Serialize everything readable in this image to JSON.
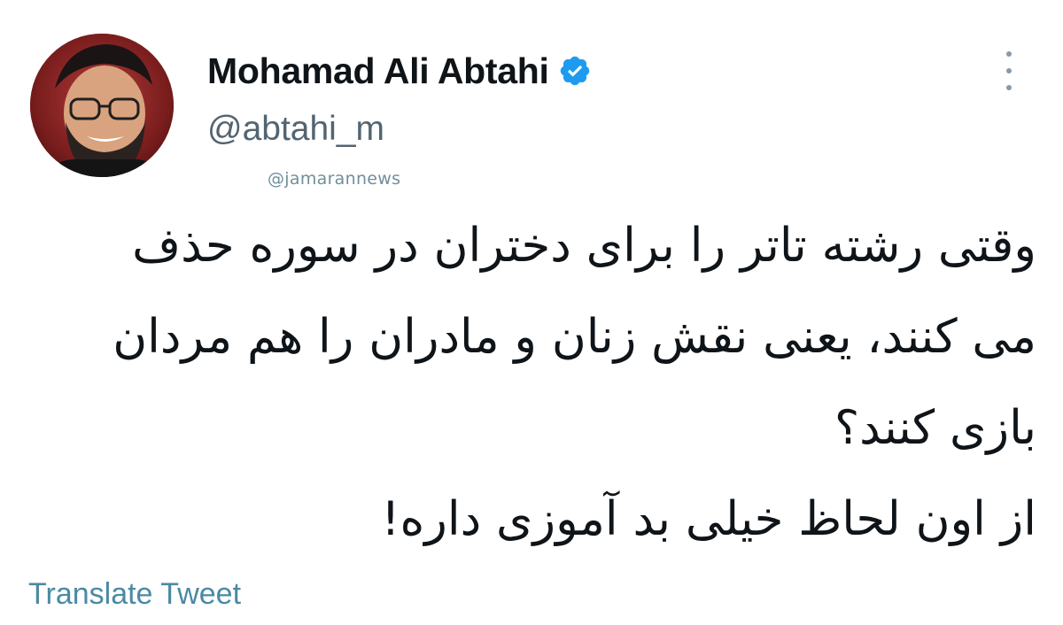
{
  "author": {
    "display_name": "Mohamad Ali Abtahi",
    "handle": "@abtahi_m",
    "verified_icon": "verified-badge-icon",
    "avatar_icon": "profile-photo"
  },
  "watermark": "@jamarannews",
  "more_icon": "more-vertical-icon",
  "tweet": {
    "lines": [
      "وقتی رشته تاتر را برای دختران در سوره حذف",
      "می کنند، یعنی نقش زنان و مادران را هم مردان",
      "بازی کنند؟",
      "از اون لحاظ خیلی بد آموزی داره!"
    ]
  },
  "translate_label": "Translate Tweet",
  "colors": {
    "text": "#0f1419",
    "secondary": "#536471",
    "verified": "#1d9bf0",
    "link": "#4a8aa3"
  }
}
